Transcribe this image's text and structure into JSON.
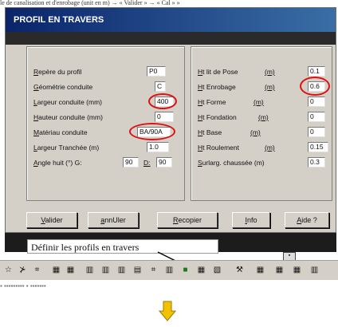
{
  "top_caption": "le de canalisation et d'enrobage (unit en m) → « Valider » → « Cal » »",
  "dialog": {
    "title": "PROFIL EN TRAVERS",
    "left_fields": [
      {
        "label": "Repère du profil",
        "value": "P0"
      },
      {
        "label": "Géométrie conduite",
        "value": "C"
      },
      {
        "label": "Largeur conduite (mm)",
        "value": "400"
      },
      {
        "label": "Hauteur conduite (mm)",
        "value": "0"
      },
      {
        "label": "Matériau conduite",
        "value": "BA/90A"
      },
      {
        "label": "Largeur Tranchée (m)",
        "value": "1.0"
      }
    ],
    "angle": {
      "label": "Angle huit (°) G:",
      "g_value": "90",
      "d_label": "D:",
      "d_value": "90"
    },
    "right_fields": [
      {
        "label": "Ht lit de Pose",
        "unit": "(m)",
        "value": "0.1"
      },
      {
        "label": "Ht Enrobage",
        "unit": "(m)",
        "value": "0.6"
      },
      {
        "label": "Ht Forme",
        "unit": "(m)",
        "value": "0"
      },
      {
        "label": "Ht Fondation",
        "unit": "(m)",
        "value": "0"
      },
      {
        "label": "Ht Base",
        "unit": "(m)",
        "value": "0"
      },
      {
        "label": "Ht Roulement",
        "unit": "(m)",
        "value": "0.15"
      },
      {
        "label": "Surlarg. chaussée (m)",
        "unit": "",
        "value": "0.3"
      }
    ],
    "buttons": [
      "Valider",
      "annUler",
      "Recopier",
      "Info",
      "Aide ?"
    ]
  },
  "tooltip": "Définir les profils en travers",
  "scroll_glyph": "▪",
  "toolbar_icons": [
    "☆",
    "⊁",
    "⌗",
    "▦",
    "▦",
    "▥",
    "▥",
    "▥",
    "▤",
    "⌗",
    "▥",
    "■",
    "▦",
    "▧",
    "⚒",
    "▦",
    "▦",
    "▦",
    "▥"
  ],
  "fade_text": "▪ ▪▪▪▪▪▪▪▪▪ ▪  ▪▪▪▪▪▪▪",
  "colors": {
    "accent": "#0a246a",
    "highlight": "#d11111",
    "arrow": "#f2c200"
  }
}
